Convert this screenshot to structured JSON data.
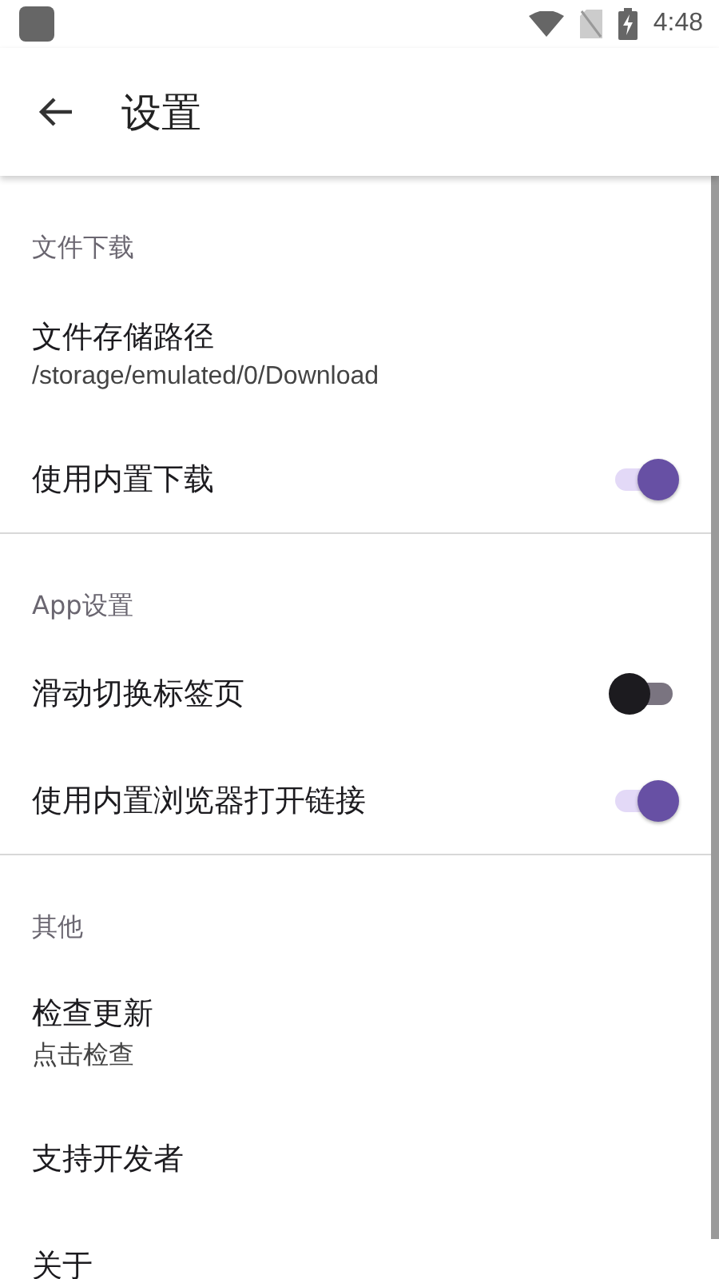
{
  "status_bar": {
    "time": "4:48"
  },
  "app_bar": {
    "title": "设置"
  },
  "sections": [
    {
      "header": "文件下载",
      "items": [
        {
          "kind": "detail",
          "title": "文件存储路径",
          "subtitle": "/storage/emulated/0/Download"
        },
        {
          "kind": "switch",
          "title": "使用内置下载",
          "on": true
        }
      ]
    },
    {
      "header": "App设置",
      "items": [
        {
          "kind": "switch",
          "title": "滑动切换标签页",
          "on": false
        },
        {
          "kind": "switch",
          "title": "使用内置浏览器打开链接",
          "on": true
        }
      ]
    },
    {
      "header": "其他",
      "items": [
        {
          "kind": "detail",
          "title": "检查更新",
          "subtitle": "点击检查"
        },
        {
          "kind": "plain",
          "title": "支持开发者"
        },
        {
          "kind": "plain",
          "title": "关于"
        }
      ]
    }
  ]
}
